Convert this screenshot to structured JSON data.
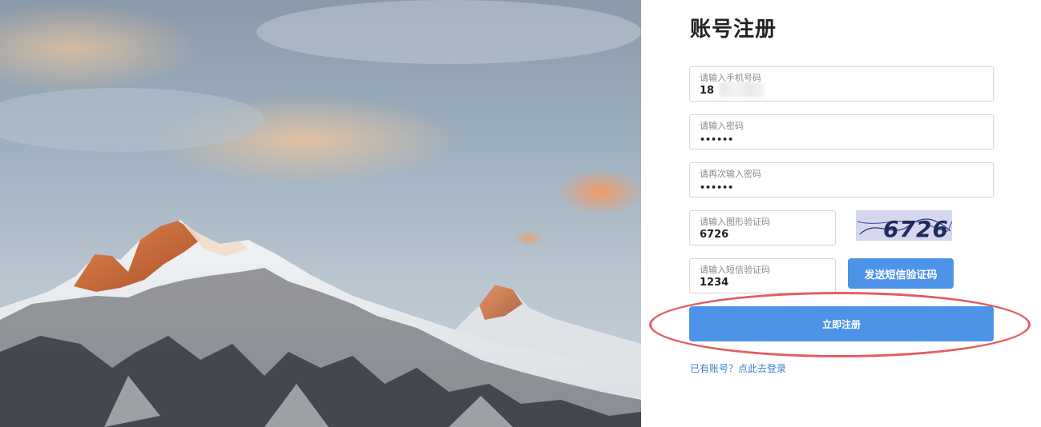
{
  "register": {
    "title": "账号注册",
    "phone": {
      "placeholder": "请输入手机号码",
      "value": "18"
    },
    "password": {
      "placeholder": "请输入密码",
      "value": "••••••"
    },
    "password_confirm": {
      "placeholder": "请再次输入密码",
      "value": "••••••"
    },
    "image_captcha": {
      "placeholder": "请输入图形验证码",
      "value": "6726",
      "captcha_text": "6726"
    },
    "sms_code": {
      "placeholder": "请输入短信验证码",
      "value": "1234"
    },
    "send_sms_label": "发送短信验证码",
    "submit_label": "立即注册",
    "login_link": "已有账号？点此去登录"
  },
  "colors": {
    "primary": "#4d93e8",
    "highlight": "#e45c5f",
    "link": "#3f7fc8"
  },
  "icons": {
    "captcha": "captcha-image"
  }
}
